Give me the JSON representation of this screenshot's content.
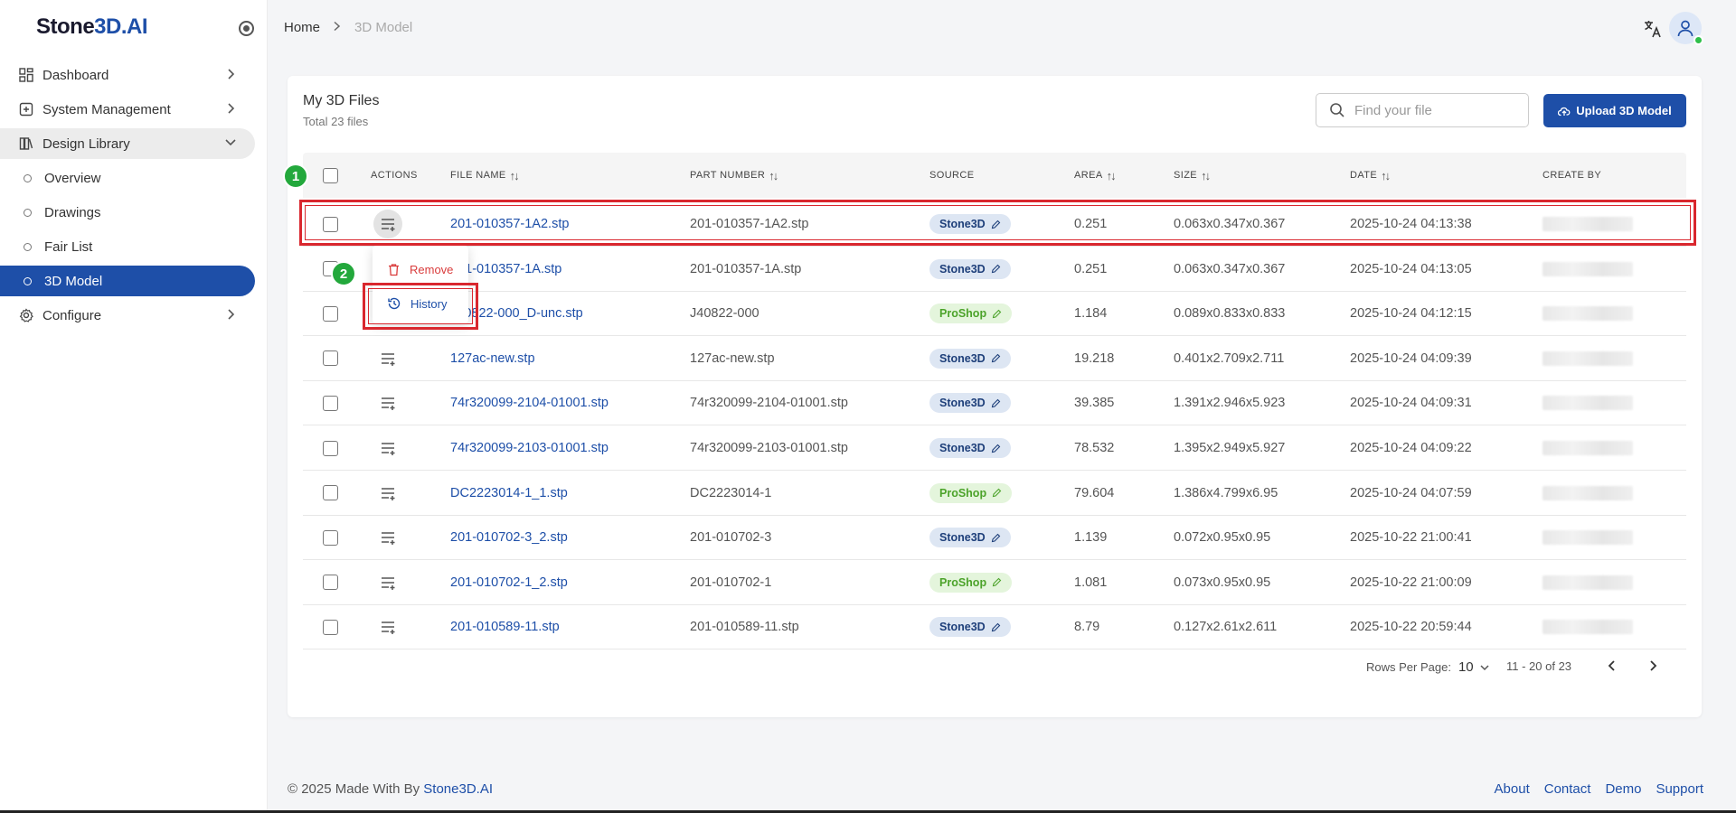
{
  "app": {
    "logo_text_a": "Stone",
    "logo_text_b": "3D.AI"
  },
  "sidebar": {
    "items": [
      {
        "label": "Dashboard",
        "icon": "dashboard-icon"
      },
      {
        "label": "System Management",
        "icon": "system-icon"
      },
      {
        "label": "Design Library",
        "icon": "library-icon"
      },
      {
        "label": "Overview"
      },
      {
        "label": "Drawings"
      },
      {
        "label": "Fair List"
      },
      {
        "label": "3D Model"
      },
      {
        "label": "Configure",
        "icon": "gear-icon"
      }
    ]
  },
  "breadcrumb": {
    "home": "Home",
    "current": "3D Model"
  },
  "card": {
    "title": "My 3D Files",
    "subtitle": "Total 23 files",
    "search_placeholder": "Find your file",
    "upload_label": "Upload 3D Model"
  },
  "table": {
    "headers": {
      "actions": "ACTIONS",
      "file_name": "FILE NAME",
      "part_number": "PART NUMBER",
      "source": "SOURCE",
      "area": "AREA",
      "size": "SIZE",
      "date": "DATE",
      "create_by": "CREATE BY"
    },
    "rows": [
      {
        "file": "201-010357-1A2.stp",
        "part": "201-010357-1A2.stp",
        "source": "Stone3D",
        "area": "0.251",
        "size": "0.063x0.347x0.367",
        "date": "2025-10-24 04:13:38"
      },
      {
        "file": "201-010357-1A.stp",
        "part": "201-010357-1A.stp",
        "source": "Stone3D",
        "area": "0.251",
        "size": "0.063x0.347x0.367",
        "date": "2025-10-24 04:13:05"
      },
      {
        "file": "J40822-000_D-unc.stp",
        "part": "J40822-000",
        "source": "ProShop",
        "area": "1.184",
        "size": "0.089x0.833x0.833",
        "date": "2025-10-24 04:12:15"
      },
      {
        "file": "127ac-new.stp",
        "part": "127ac-new.stp",
        "source": "Stone3D",
        "area": "19.218",
        "size": "0.401x2.709x2.711",
        "date": "2025-10-24 04:09:39"
      },
      {
        "file": "74r320099-2104-01001.stp",
        "part": "74r320099-2104-01001.stp",
        "source": "Stone3D",
        "area": "39.385",
        "size": "1.391x2.946x5.923",
        "date": "2025-10-24 04:09:31"
      },
      {
        "file": "74r320099-2103-01001.stp",
        "part": "74r320099-2103-01001.stp",
        "source": "Stone3D",
        "area": "78.532",
        "size": "1.395x2.949x5.927",
        "date": "2025-10-24 04:09:22"
      },
      {
        "file": "DC2223014-1_1.stp",
        "part": "DC2223014-1",
        "source": "ProShop",
        "area": "79.604",
        "size": "1.386x4.799x6.95",
        "date": "2025-10-24 04:07:59"
      },
      {
        "file": "201-010702-3_2.stp",
        "part": "201-010702-3",
        "source": "Stone3D",
        "area": "1.139",
        "size": "0.072x0.95x0.95",
        "date": "2025-10-22 21:00:41"
      },
      {
        "file": "201-010702-1_2.stp",
        "part": "201-010702-1",
        "source": "ProShop",
        "area": "1.081",
        "size": "0.073x0.95x0.95",
        "date": "2025-10-22 21:00:09"
      },
      {
        "file": "201-010589-11.stp",
        "part": "201-010589-11.stp",
        "source": "Stone3D",
        "area": "8.79",
        "size": "0.127x2.61x2.611",
        "date": "2025-10-22 20:59:44"
      }
    ]
  },
  "menu": {
    "remove": "Remove",
    "history": "History"
  },
  "pagination": {
    "rows_label": "Rows Per Page:",
    "rows_value": "10",
    "range": "11 - 20 of 23"
  },
  "annotations": {
    "marker1": "1",
    "marker2": "2"
  },
  "footer": {
    "copyright": "© 2025 Made With By ",
    "brand": "Stone3D.AI",
    "links": [
      "About",
      "Contact",
      "Demo",
      "Support"
    ]
  },
  "colors": {
    "primary": "#1e4fa8",
    "highlight": "#d9272e",
    "marker": "#23a83c",
    "proshop_badge": "#e4f5dc",
    "stone3d_badge": "#dde6f3"
  }
}
